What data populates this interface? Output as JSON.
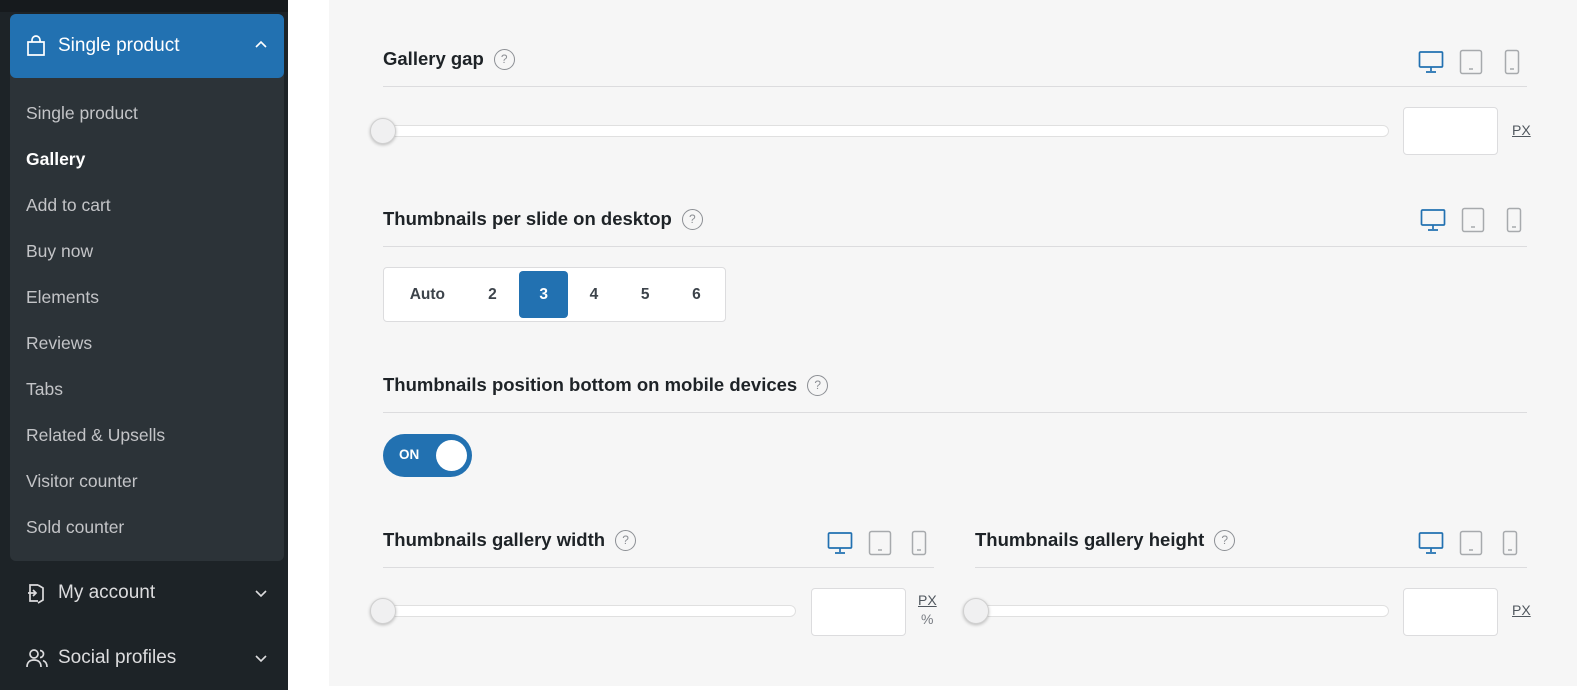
{
  "sidebar": {
    "open_group": {
      "label": "Single product",
      "icon": "shopping-bag-icon",
      "items": [
        {
          "label": "Single product",
          "active": false
        },
        {
          "label": "Gallery",
          "active": true
        },
        {
          "label": "Add to cart",
          "active": false
        },
        {
          "label": "Buy now",
          "active": false
        },
        {
          "label": "Elements",
          "active": false
        },
        {
          "label": "Reviews",
          "active": false
        },
        {
          "label": "Tabs",
          "active": false
        },
        {
          "label": "Related & Upsells",
          "active": false
        },
        {
          "label": "Visitor counter",
          "active": false
        },
        {
          "label": "Sold counter",
          "active": false
        }
      ]
    },
    "closed_groups": [
      {
        "label": "My account",
        "icon": "login-icon"
      },
      {
        "label": "Social profiles",
        "icon": "users-icon"
      }
    ]
  },
  "settings": {
    "help_glyph": "?",
    "gallery_gap": {
      "title": "Gallery gap",
      "value": "",
      "unit": "PX"
    },
    "thumbnails_per_slide": {
      "title": "Thumbnails per slide on desktop",
      "options": [
        "Auto",
        "2",
        "3",
        "4",
        "5",
        "6"
      ],
      "selected": "3"
    },
    "thumbnails_position_mobile": {
      "title": "Thumbnails position bottom on mobile devices",
      "toggle_label": "ON",
      "enabled": true
    },
    "thumbnails_gallery_width": {
      "title": "Thumbnails gallery width",
      "value": "",
      "unit": "PX",
      "alt_unit": "%"
    },
    "thumbnails_gallery_height": {
      "title": "Thumbnails gallery height",
      "value": "",
      "unit": "PX"
    }
  },
  "colors": {
    "accent": "#2271b1",
    "sidebar_bg": "#1d2327",
    "sidebar_group_bg": "#2c3338",
    "main_bg": "#f6f6f6",
    "device_active": "#2271b1",
    "device_inactive": "#a7aaad"
  }
}
